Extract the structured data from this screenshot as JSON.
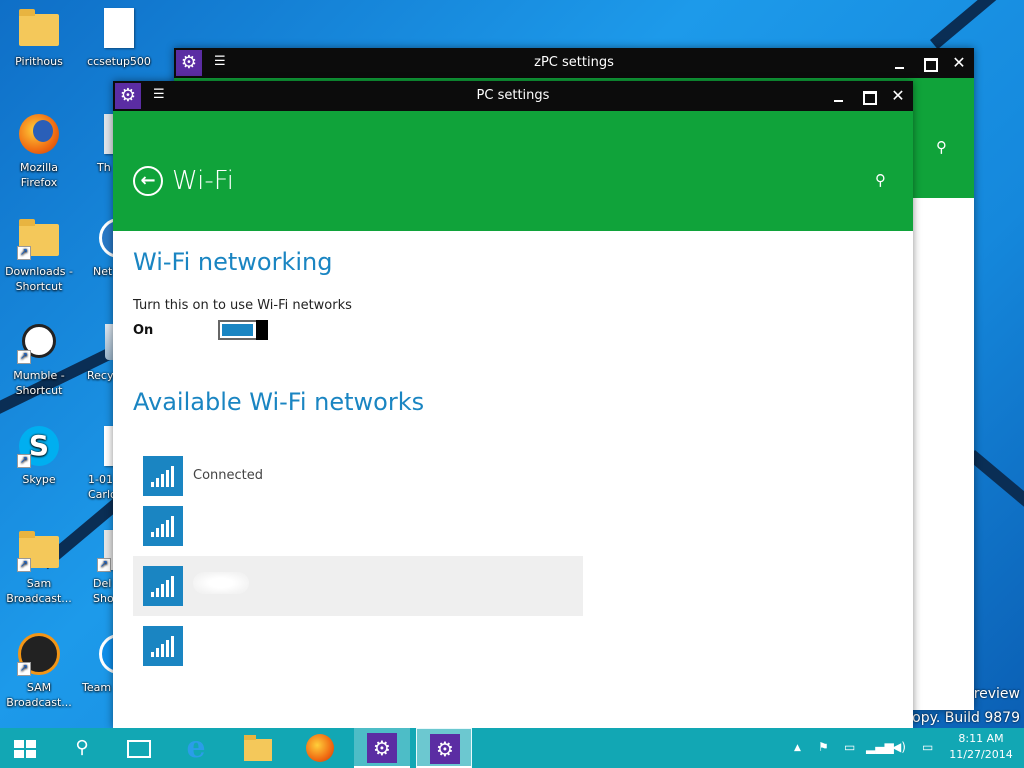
{
  "desktop": {
    "icons_left": [
      {
        "label": "Pirithous",
        "icon": "user-folder-icon"
      },
      {
        "label": "Mozilla Firefox",
        "icon": "firefox-icon"
      },
      {
        "label": "Downloads - Shortcut",
        "icon": "downloads-folder-icon"
      },
      {
        "label": "Mumble - Shortcut",
        "icon": "mumble-icon"
      },
      {
        "label": "Skype",
        "icon": "skype-icon"
      },
      {
        "label": "Sam Broadcast...",
        "icon": "sam-folder-icon"
      },
      {
        "label": "SAM Broadcast...",
        "icon": "sam-broadcaster-icon"
      }
    ],
    "icons_right": [
      {
        "label": "ccsetup500",
        "icon": "document-icon"
      },
      {
        "label": "Th",
        "icon": "computer-icon"
      },
      {
        "label": "Net",
        "icon": "network-icon"
      },
      {
        "label": "Recy",
        "icon": "recycle-bin-icon"
      },
      {
        "label": "1-01 Carlo",
        "icon": "document-icon"
      },
      {
        "label": "Del Sho",
        "icon": "shortcut-icon"
      },
      {
        "label": "Team",
        "icon": "teamviewer-icon"
      }
    ],
    "watermark_line1": "review",
    "watermark_line2": "copy. Build 9879"
  },
  "back_window": {
    "title": "zPC settings",
    "app_icon": "gear-icon"
  },
  "front_window": {
    "title": "PC settings",
    "app_icon": "gear-icon",
    "page_title": "Wi-Fi",
    "section1": {
      "heading": "Wi-Fi networking",
      "description": "Turn this on to use Wi-Fi networks",
      "toggle_state": "On",
      "toggle_on": true
    },
    "section2": {
      "heading": "Available Wi-Fi networks",
      "networks": [
        {
          "status": "Connected",
          "signal_bars": 5,
          "icon": "wifi-signal-icon"
        },
        {
          "status": "",
          "signal_bars": 5,
          "icon": "wifi-signal-icon"
        },
        {
          "status": "",
          "signal_bars": 5,
          "icon": "wifi-signal-icon"
        },
        {
          "status": "",
          "signal_bars": 5,
          "icon": "wifi-signal-icon"
        }
      ]
    }
  },
  "taskbar": {
    "items": [
      "start-icon",
      "search-icon",
      "task-view-icon",
      "internet-explorer-icon",
      "file-explorer-icon",
      "firefox-icon",
      "pc-settings-icon",
      "pc-settings-icon"
    ],
    "tray": {
      "up_arrow": "▲",
      "flag": "flag-icon",
      "battery": "battery-icon",
      "network": "network-icon",
      "volume": "volume-icon",
      "keyboard": "keyboard-icon"
    },
    "time": "8:11 AM",
    "date": "11/27/2014"
  },
  "colors": {
    "accent_green": "#10a33a",
    "accent_blue": "#1a85c2",
    "app_purple": "#5b2da3",
    "taskbar": "#12a7b4"
  }
}
